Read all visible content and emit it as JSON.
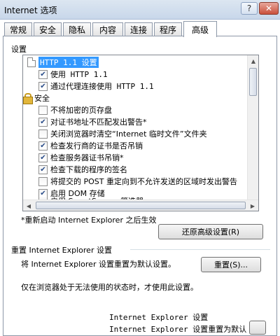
{
  "window": {
    "title": "Internet 选项"
  },
  "tabs": [
    "常规",
    "安全",
    "隐私",
    "内容",
    "连接",
    "程序",
    "高级"
  ],
  "settings": {
    "group_label": "设置",
    "items": [
      {
        "type": "header",
        "icon": "page-icon",
        "label": "HTTP 1.1 设置",
        "selected": true
      },
      {
        "type": "checkbox",
        "label": "使用 HTTP 1.1",
        "checked": true
      },
      {
        "type": "checkbox",
        "label": "通过代理连接使用 HTTP 1.1",
        "checked": true
      },
      {
        "type": "header",
        "icon": "lock-icon",
        "label": "安全"
      },
      {
        "type": "checkbox",
        "label": "不将加密的页存盘",
        "checked": false
      },
      {
        "type": "checkbox",
        "label": "对证书地址不匹配发出警告*",
        "checked": true
      },
      {
        "type": "checkbox",
        "label": "关闭浏览器时清空“Internet 临时文件”文件夹",
        "checked": false
      },
      {
        "type": "checkbox",
        "label": "检查发行商的证书是否吊销",
        "checked": true
      },
      {
        "type": "checkbox",
        "label": "检查服务器证书吊销*",
        "checked": true
      },
      {
        "type": "checkbox",
        "label": "检查下载的程序的签名",
        "checked": true
      },
      {
        "type": "checkbox",
        "label": "将提交的 POST 重定向到不允许发送的区域时发出警告",
        "checked": false
      },
      {
        "type": "checkbox",
        "label": "启用 DOM 存储",
        "checked": true
      },
      {
        "type": "checkbox",
        "label": "启用 SmartScreen 筛选器",
        "checked": false
      }
    ]
  },
  "restart_note": "*重新启动 Internet Explorer 之后生效",
  "restore_button": "还原高级设置(R)",
  "reset_section": {
    "title": "重置 Internet Explorer 设置",
    "description": "将 Internet Explorer 设置重置为默认设置。",
    "button": "重置(S)...",
    "note": "仅在浏览器处于无法使用的状态时，才使用此设置。"
  },
  "overlay": {
    "line1": "Internet Explorer 设置",
    "line2": "Internet Explorer 设置重置为默认"
  }
}
